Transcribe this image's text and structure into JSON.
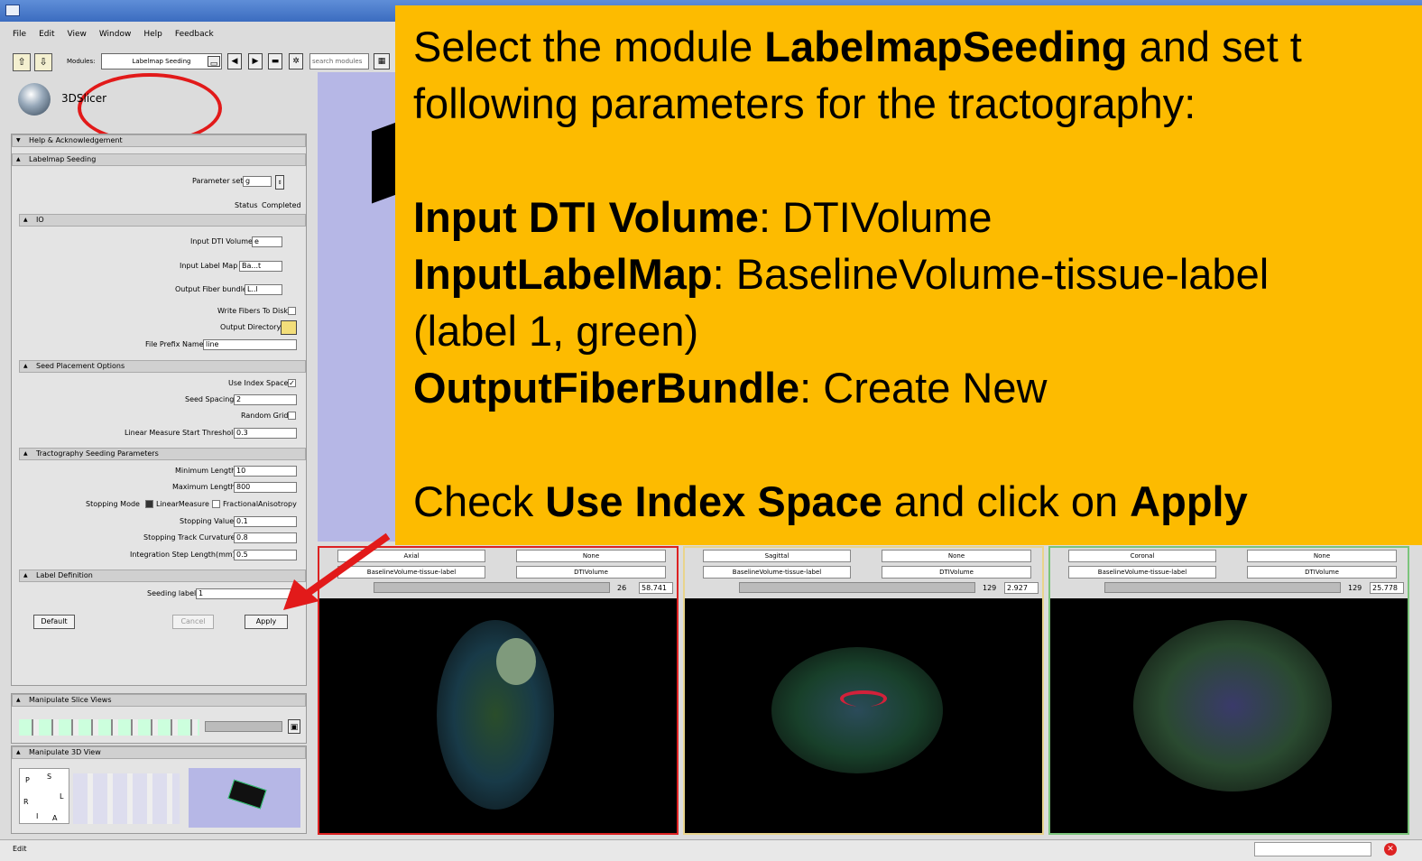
{
  "menu": {
    "file": "File",
    "edit": "Edit",
    "view": "View",
    "window": "Window",
    "help": "Help",
    "feedback": "Feedback"
  },
  "toolbar": {
    "modules_label": "Modules:",
    "module_value": "Labelmap Seeding",
    "search_placeholder": "search modules"
  },
  "logo": {
    "text": "3DSlicer"
  },
  "sections": {
    "help": "Help & Acknowledgement",
    "labelmap": "Labelmap Seeding",
    "io": "IO",
    "seed": "Seed Placement Options",
    "tract": "Tractography Seeding Parameters",
    "label_def": "Label Definition",
    "manip_slice": "Manipulate Slice Views",
    "manip_3d": "Manipulate 3D View"
  },
  "params": {
    "parameter_set_label": "Parameter set",
    "parameter_set_value": "g",
    "status_label": "Status",
    "status_value": "Completed",
    "input_dti_label": "Input DTI Volume",
    "input_dti_value": "e",
    "input_label_label": "Input Label Map",
    "input_label_value": "Ba...t",
    "output_fiber_label": "Output Fiber bundle",
    "output_fiber_value": "L..l",
    "write_fibers_label": "Write Fibers To Disk",
    "output_dir_label": "Output Directory",
    "file_prefix_label": "File Prefix Name",
    "file_prefix_value": "line",
    "use_index_label": "Use Index Space",
    "seed_spacing_label": "Seed Spacing",
    "seed_spacing_value": "2",
    "random_grid_label": "Random Grid",
    "linear_thresh_label": "Linear Measure Start Threshold",
    "linear_thresh_value": "0.3",
    "min_len_label": "Minimum Length",
    "min_len_value": "10",
    "max_len_label": "Maximum Length",
    "max_len_value": "800",
    "stop_mode_label": "Stopping Mode",
    "stop_mode_opt1": "LinearMeasure",
    "stop_mode_opt2": "FractionalAnisotropy",
    "stop_val_label": "Stopping Value",
    "stop_val_value": "0.1",
    "stop_curv_label": "Stopping Track Curvature",
    "stop_curv_value": "0.8",
    "step_label": "Integration Step Length(mm)",
    "step_value": "0.5",
    "seeding_label_label": "Seeding label",
    "seeding_label_value": "1"
  },
  "buttons": {
    "default": "Default",
    "cancel": "Cancel",
    "apply": "Apply"
  },
  "views": [
    {
      "orient": "Axial",
      "fg": "None",
      "label": "BaselineVolume-tissue-label",
      "bg": "DTIVolume",
      "slice": "26",
      "offset": "58.741"
    },
    {
      "orient": "Sagittal",
      "fg": "None",
      "label": "BaselineVolume-tissue-label",
      "bg": "DTIVolume",
      "slice": "129",
      "offset": "2.927"
    },
    {
      "orient": "Coronal",
      "fg": "None",
      "label": "BaselineVolume-tissue-label",
      "bg": "DTIVolume",
      "slice": "129",
      "offset": "25.778"
    }
  ],
  "orientation_cube": {
    "p": "P",
    "s": "S",
    "l": "L",
    "r": "R",
    "i": "I",
    "a": "A"
  },
  "callout": {
    "line1a": "Select the module ",
    "line1b": "LabelmapSeeding",
    "line1c": " and set t",
    "line2": "following parameters for the tractography:",
    "line3a": "Input DTI Volume",
    "line3b": ": DTIVolume",
    "line4a": "InputLabelMap",
    "line4b": ": BaselineVolume-tissue-label",
    "line5": "(label 1, green)",
    "line6a": "OutputFiberBundle",
    "line6b": ": Create New",
    "line7a": "Check ",
    "line7b": "Use Index Space",
    "line7c": " and click on ",
    "line7d": "Apply"
  },
  "status": {
    "text": "Edit"
  }
}
